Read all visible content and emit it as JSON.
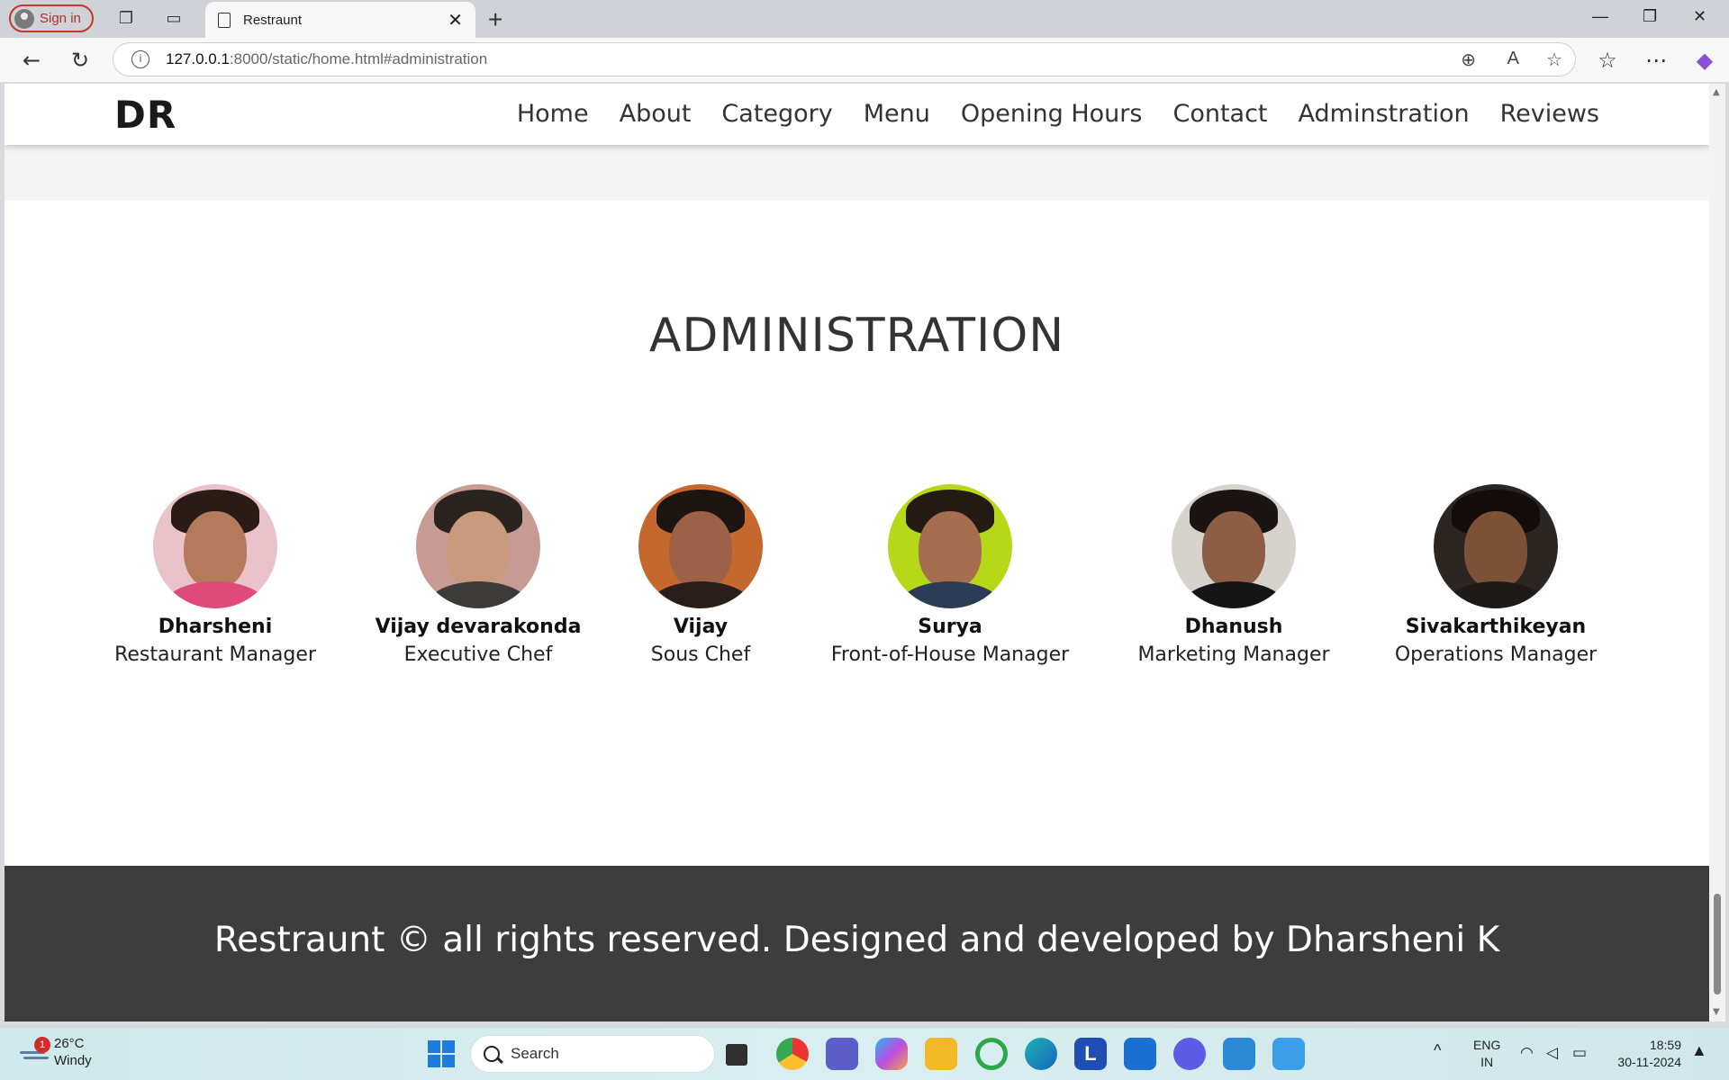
{
  "browser": {
    "signin_label": "Sign in",
    "tab_title": "Restraunt",
    "url_host": "127.0.0.1",
    "url_path": ":8000/static/home.html#administration"
  },
  "site": {
    "logo": "DR",
    "nav": [
      "Home",
      "About",
      "Category",
      "Menu",
      "Opening Hours",
      "Contact",
      "Adminstration",
      "Reviews"
    ],
    "section_title": "ADMINISTRATION",
    "team": [
      {
        "name": "Dharsheni",
        "role": "Restaurant Manager"
      },
      {
        "name": "Vijay devarakonda",
        "role": "Executive Chef"
      },
      {
        "name": "Vijay",
        "role": "Sous Chef"
      },
      {
        "name": "Surya",
        "role": "Front-of-House Manager"
      },
      {
        "name": "Dhanush",
        "role": "Marketing Manager"
      },
      {
        "name": "Sivakarthikeyan",
        "role": "Operations Manager"
      }
    ],
    "footer": "Restraunt © all rights reserved. Designed and developed by Dharsheni K"
  },
  "taskbar": {
    "temperature": "26°C",
    "weather": "Windy",
    "weather_badge": "1",
    "search_placeholder": "Search",
    "lang_top": "ENG",
    "lang_bottom": "IN",
    "time": "18:59",
    "date": "30-11-2024"
  }
}
